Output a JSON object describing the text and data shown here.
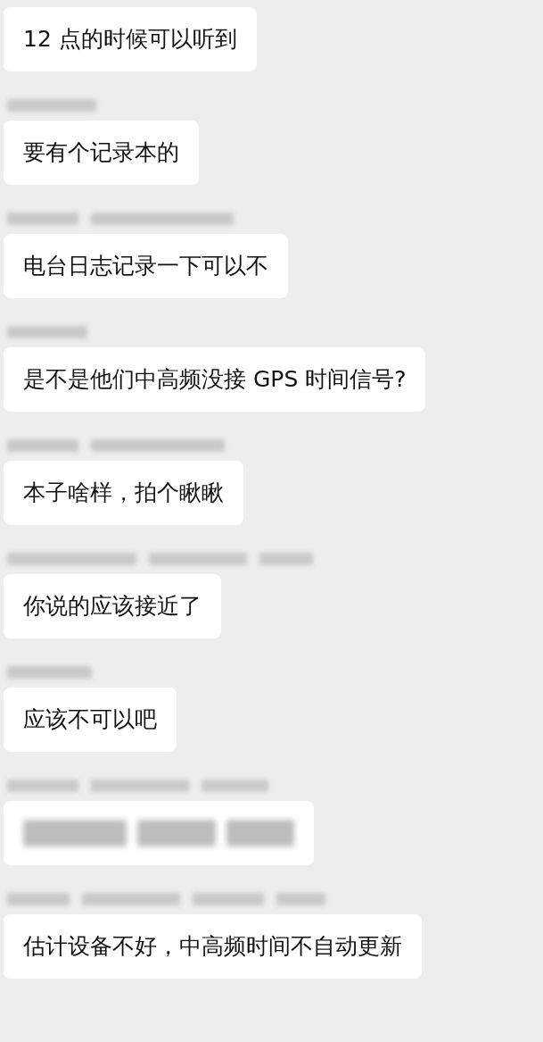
{
  "chat": [
    {
      "kind": "message",
      "text": "12 点的时候可以听到"
    },
    {
      "kind": "blurred-name"
    },
    {
      "kind": "message",
      "text": "要有个记录本的"
    },
    {
      "kind": "blurred-name"
    },
    {
      "kind": "message",
      "text": "电台日志记录一下可以不"
    },
    {
      "kind": "blurred-name"
    },
    {
      "kind": "message",
      "text": "是不是他们中高频没接 GPS 时间信号?"
    },
    {
      "kind": "blurred-name"
    },
    {
      "kind": "message",
      "text": "本子啥样，拍个瞅瞅"
    },
    {
      "kind": "blurred-name"
    },
    {
      "kind": "message",
      "text": "你说的应该接近了"
    },
    {
      "kind": "blurred-name"
    },
    {
      "kind": "message",
      "text": "应该不可以吧"
    },
    {
      "kind": "blurred-name"
    },
    {
      "kind": "blurred-message"
    },
    {
      "kind": "blurred-name"
    },
    {
      "kind": "message",
      "text": "估计设备不好，中高频时间不自动更新"
    }
  ]
}
